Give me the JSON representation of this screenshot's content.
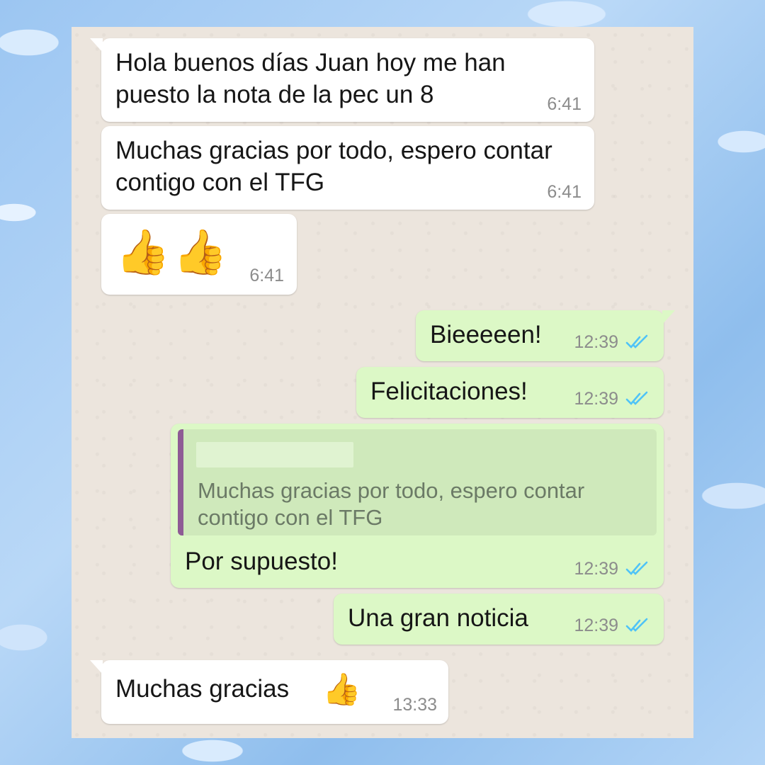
{
  "messages": [
    {
      "text": "Hola buenos días Juan hoy me han puesto la nota de la pec un 8",
      "time": "6:41"
    },
    {
      "text": "Muchas gracias por todo, espero contar contigo con el TFG",
      "time": "6:41"
    },
    {
      "text": "👍👍",
      "time": "6:41"
    },
    {
      "text": "Bieeeeen!",
      "time": "12:39"
    },
    {
      "text": "Felicitaciones!",
      "time": "12:39"
    },
    {
      "quote": "Muchas gracias por todo, espero contar contigo con el TFG",
      "text": "Por supuesto!",
      "time": "12:39"
    },
    {
      "text": "Una gran noticia",
      "time": "12:39"
    },
    {
      "text": "Muchas gracias",
      "time": "13:33"
    }
  ],
  "colors": {
    "incoming_bubble": "#ffffff",
    "outgoing_bubble": "#dcf8c6",
    "read_ticks": "#4fc3f7",
    "quote_bar": "#8e5b95",
    "chat_background": "#ece5dd"
  }
}
